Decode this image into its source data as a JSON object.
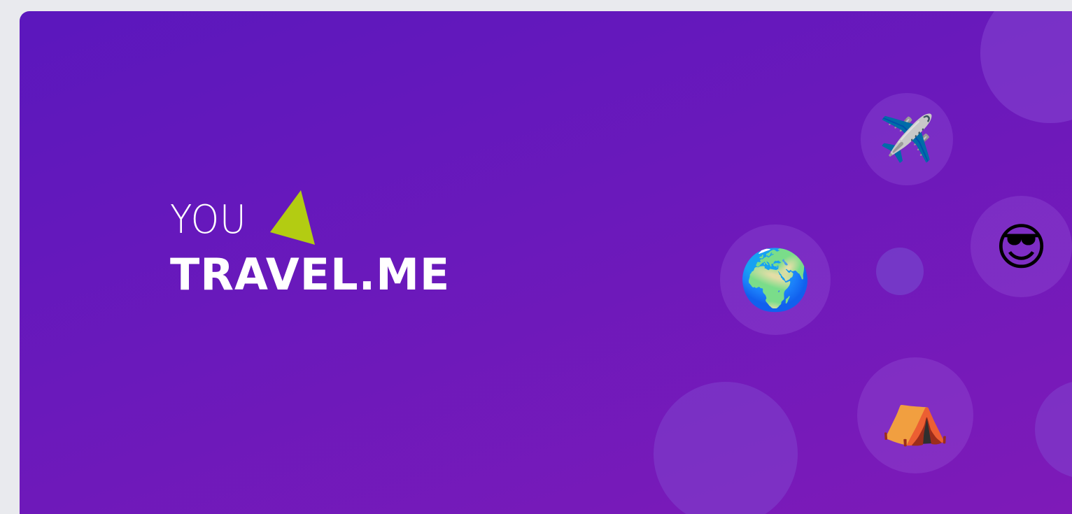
{
  "banner": {
    "logo": {
      "line1": "YOU",
      "line2": "TRAVEL.ME",
      "arrow_color": "#b3cc12"
    },
    "bubbles": [
      {
        "icon": "airplane-icon",
        "glyph": "✈️"
      },
      {
        "icon": "globe-icon",
        "glyph": "🌍"
      },
      {
        "icon": "smiling-sunglasses-icon",
        "glyph": "😎"
      },
      {
        "icon": "camping-tent-icon",
        "glyph": "⛺"
      }
    ],
    "colors": {
      "gradient_start": "#5b17bd",
      "gradient_end": "#7e1ab8",
      "page_background": "#e9eaee"
    }
  }
}
